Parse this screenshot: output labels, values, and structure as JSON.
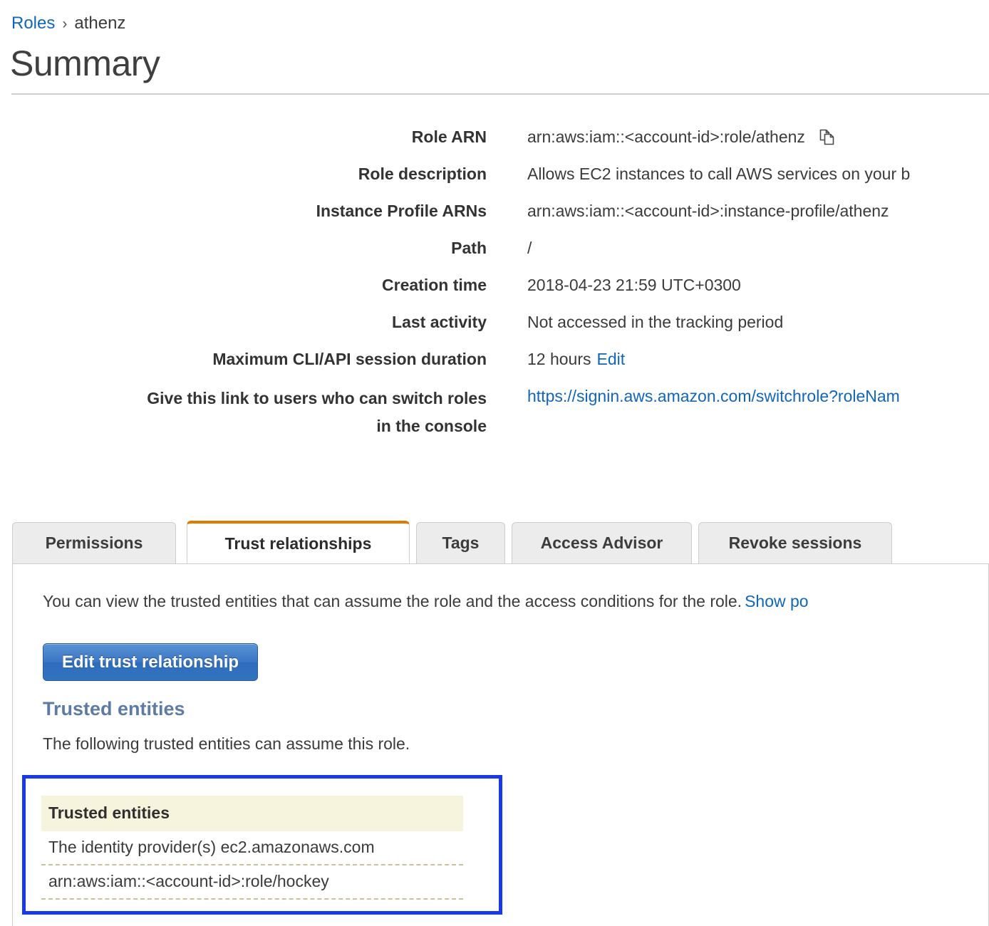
{
  "breadcrumb": {
    "parent": "Roles",
    "separator": "›",
    "current": "athenz"
  },
  "page_title": "Summary",
  "properties": [
    {
      "label": "Role ARN",
      "value": "arn:aws:iam::<account-id>:role/athenz",
      "icon": "copy-icon"
    },
    {
      "label": "Role description",
      "value": "Allows EC2 instances to call AWS services on your b"
    },
    {
      "label": "Instance Profile ARNs",
      "value": "arn:aws:iam::<account-id>:instance-profile/athenz"
    },
    {
      "label": "Path",
      "value": "/"
    },
    {
      "label": "Creation time",
      "value": "2018-04-23 21:59 UTC+0300"
    },
    {
      "label": "Last activity",
      "value": "Not accessed in the tracking period"
    },
    {
      "label": "Maximum CLI/API session duration",
      "value": "12 hours",
      "link": "Edit"
    },
    {
      "label_line1": "Give this link to users who can switch roles",
      "label_line2": "in the console",
      "link_value": "https://signin.aws.amazon.com/switchrole?roleNam"
    }
  ],
  "tabs": [
    {
      "label": "Permissions",
      "active": false
    },
    {
      "label": "Trust relationships",
      "active": true
    },
    {
      "label": "Tags",
      "active": false
    },
    {
      "label": "Access Advisor",
      "active": false
    },
    {
      "label": "Revoke sessions",
      "active": false
    }
  ],
  "panel": {
    "intro_text": "You can view the trusted entities that can assume the role and the access conditions for the role.",
    "intro_link": "Show po",
    "edit_button": "Edit trust relationship",
    "section_heading": "Trusted entities",
    "section_subtext": "The following trusted entities can assume this role.",
    "table": {
      "header": "Trusted entities",
      "rows": [
        "The identity provider(s) ec2.amazonaws.com",
        "arn:aws:iam::<account-id>:role/hockey"
      ]
    }
  },
  "colors": {
    "link": "#1166bb",
    "active_tab_accent": "#e07b00",
    "section_heading": "#5d7ca5",
    "highlight_border": "#1a3ae8",
    "table_header_bg": "#f6f4dc",
    "button_blue": "#3a76c4"
  }
}
